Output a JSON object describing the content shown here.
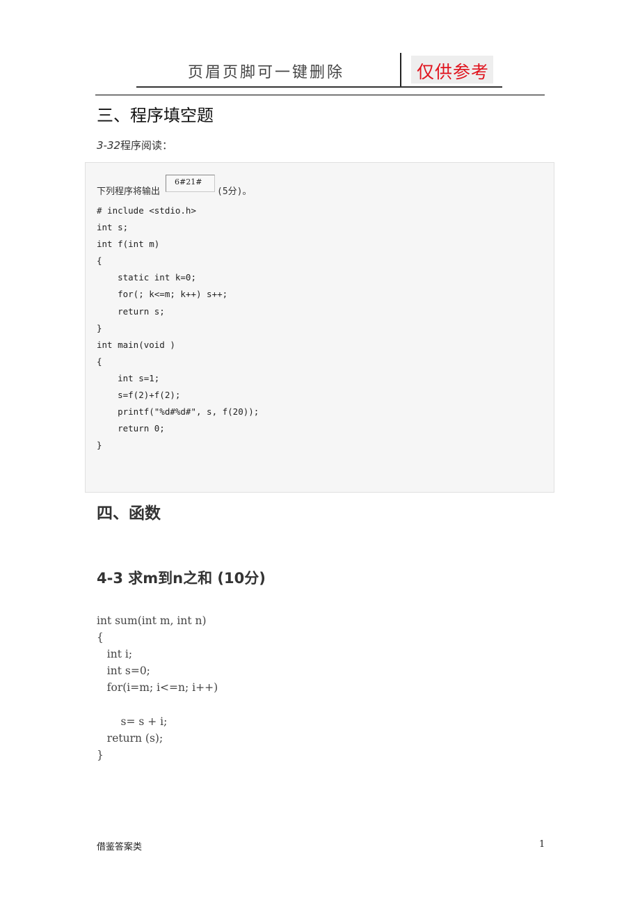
{
  "header": {
    "text": "页眉页脚可一键删除",
    "badge": "仅供参考",
    "badge_color": "#e0141e"
  },
  "section3": {
    "title": "三、程序填空题",
    "problem_id": "3-32",
    "problem_label": "程序阅读：",
    "question_prefix": "下列程序将输出",
    "answer_value": "6#21#",
    "score": "(5分)。",
    "code": "# include <stdio.h>\nint s;\nint f(int m)\n{\n    static int k=0;\n    for(; k<=m; k++) s++;\n    return s;\n}\nint main(void )\n{\n    int s=1;\n    s=f(2)+f(2);\n    printf(\"%d#%d#\", s, f(20));\n    return 0;\n}"
  },
  "section4": {
    "title": "四、函数",
    "problem_title": "4-3 求m到n之和  (10分)",
    "code": "int sum(int m, int n)\n{\n   int i;\n   int s=0;\n   for(i=m; i<=n; i++)\n\n       s= s + i;\n   return (s);\n}"
  },
  "footer": {
    "left": "借鉴答案类",
    "page_number": "1"
  }
}
